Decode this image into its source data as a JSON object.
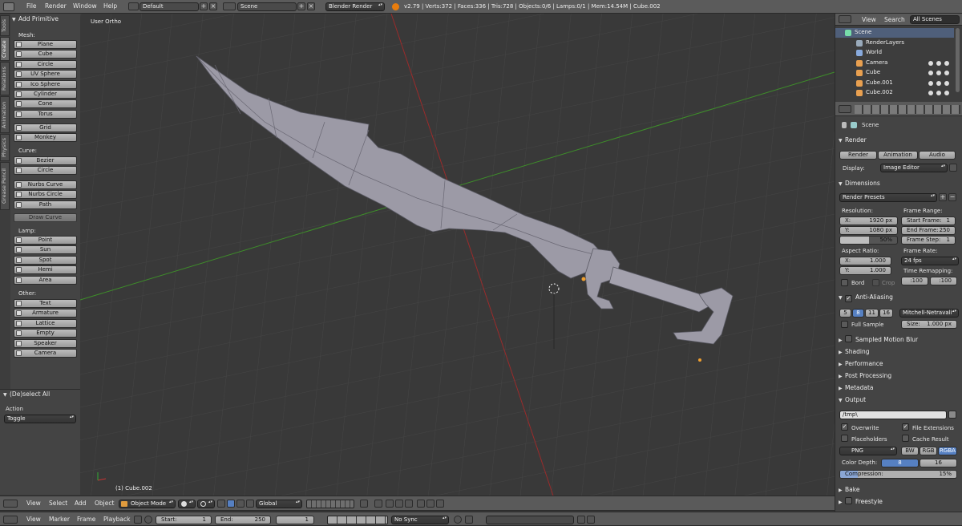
{
  "topbar": {
    "menus": [
      "File",
      "Render",
      "Window",
      "Help"
    ],
    "layout": "Default",
    "scene": "Scene",
    "engine": "Blender Render",
    "stats": "v2.79 | Verts:372 | Faces:336 | Tris:728 | Objects:0/6 | Lamps:0/1 | Mem:14.54M | Cube.002"
  },
  "toolshelf": {
    "vertical_tabs": [
      "Tools",
      "Create",
      "Relations",
      "Animation",
      "Physics",
      "Grease Pencil"
    ],
    "panel_title": "Add Primitive",
    "mesh_label": "Mesh:",
    "mesh": [
      "Plane",
      "Cube",
      "Circle",
      "UV Sphere",
      "Ico Sphere",
      "Cylinder",
      "Cone",
      "Torus"
    ],
    "mesh2": [
      "Grid",
      "Monkey"
    ],
    "curve_label": "Curve:",
    "curve": [
      "Bezier",
      "Circle"
    ],
    "curve2": [
      "Nurbs Curve",
      "Nurbs Circle",
      "Path"
    ],
    "curve_disabled": "Draw Curve",
    "lamp_label": "Lamp:",
    "lamp": [
      "Point",
      "Sun",
      "Spot",
      "Hemi",
      "Area"
    ],
    "other_label": "Other:",
    "other": [
      "Text",
      "Armature",
      "Lattice",
      "Empty",
      "Speaker",
      "Camera"
    ]
  },
  "operator": {
    "title": "(De)select All",
    "action_label": "Action",
    "action_value": "Toggle"
  },
  "viewport": {
    "view_name": "User Ortho",
    "object_name": "(1) Cube.002"
  },
  "view3d_header": {
    "menus": [
      "View",
      "Select",
      "Add",
      "Object"
    ],
    "mode": "Object Mode",
    "orientation": "Global"
  },
  "timeline": {
    "menus": [
      "View",
      "Marker",
      "Frame",
      "Playback"
    ],
    "start_label": "Start:",
    "start": "1",
    "end_label": "End:",
    "end": "250",
    "current": "1",
    "sync": "No Sync"
  },
  "outliner": {
    "tabs": [
      "View",
      "Search",
      "All Scenes"
    ],
    "items": [
      "Scene",
      "RenderLayers",
      "World",
      "Camera",
      "Cube",
      "Cube.001",
      "Cube.002"
    ]
  },
  "properties": {
    "context": "Scene",
    "render_section": "Render",
    "render_buttons": [
      "Render",
      "Animation",
      "Audio"
    ],
    "display_label": "Display:",
    "display_value": "Image Editor",
    "dimensions_section": "Dimensions",
    "render_presets": "Render Presets",
    "resolution_label": "Resolution:",
    "res_x_label": "X:",
    "res_x": "1920 px",
    "res_y_label": "Y:",
    "res_y": "1080 px",
    "res_pct": "50%",
    "frame_range_label": "Frame Range:",
    "start_frame_label": "Start Frame:",
    "start_frame": "1",
    "end_frame_label": "End Frame:",
    "end_frame": "250",
    "frame_step_label": "Frame Step:",
    "frame_step": "1",
    "aspect_label": "Aspect Ratio:",
    "aspect_x_label": "X:",
    "aspect_x": "1.000",
    "aspect_y_label": "Y:",
    "aspect_y": "1.000",
    "frame_rate_label": "Frame Rate:",
    "frame_rate": "24 fps",
    "time_remap_label": "Time Remapping:",
    "remap_old": ":100",
    "remap_new": ":100",
    "bord": "Bord",
    "crop": "Crop",
    "aa_section": "Anti-Aliasing",
    "aa_samples": [
      "5",
      "8",
      "11",
      "16"
    ],
    "aa_filter": "Mitchell-Netravali",
    "full_sample": "Full Sample",
    "size_label": "Size:",
    "size_value": "1.000 px",
    "motion_blur": "Sampled Motion Blur",
    "collapsed": [
      "Shading",
      "Performance",
      "Post Processing",
      "Metadata"
    ],
    "output_section": "Output",
    "output_path": "/tmp\\",
    "overwrite": "Overwrite",
    "file_extensions": "File Extensions",
    "placeholders": "Placeholders",
    "cache_result": "Cache Result",
    "format": "PNG",
    "color_modes": [
      "BW",
      "RGB",
      "RGBA"
    ],
    "color_depth_label": "Color Depth:",
    "color_depths": [
      "8",
      "16"
    ],
    "compression_label": "Compression:",
    "compression": "15%",
    "bake": "Bake",
    "freestyle": "Freestyle"
  },
  "colors": {
    "accent": "#5680c2",
    "background": "#393939",
    "x_axis": "#9a2b2b",
    "y_axis": "#3e8e2a"
  }
}
